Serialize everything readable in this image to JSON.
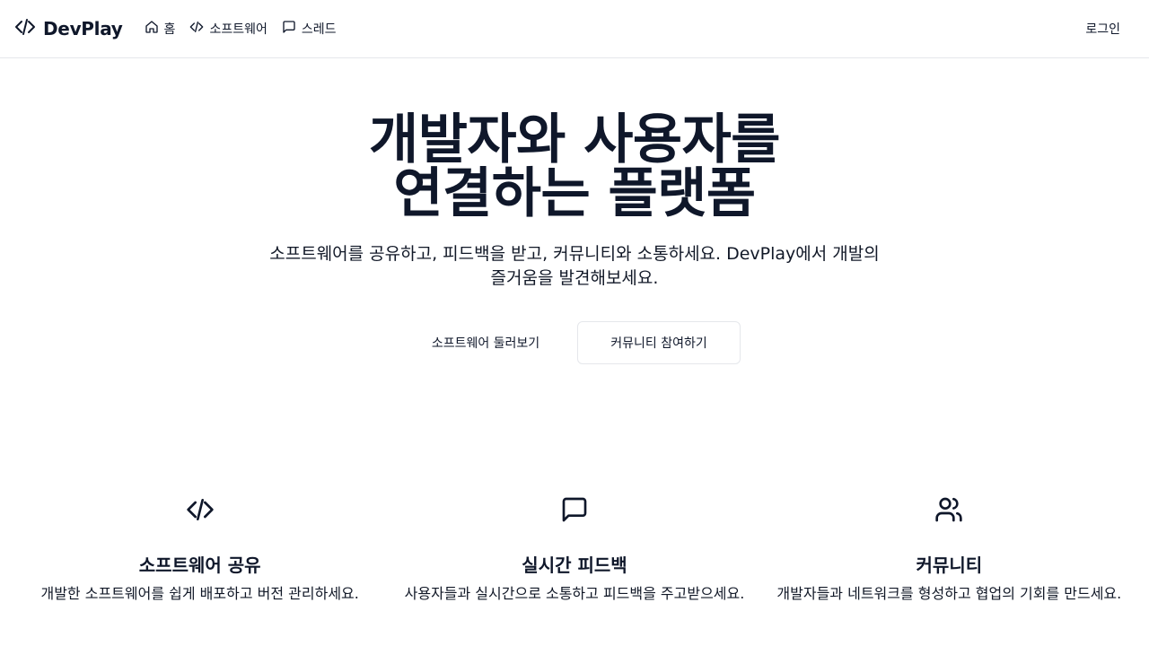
{
  "brand": {
    "name": "DevPlay",
    "icon": "code-icon"
  },
  "nav": {
    "items": [
      {
        "label": "홈",
        "icon": "home-icon"
      },
      {
        "label": "소프트웨어",
        "icon": "code-icon"
      },
      {
        "label": "스레드",
        "icon": "message-square-icon"
      }
    ],
    "login_label": "로그인"
  },
  "hero": {
    "title_line1": "개발자와 사용자를",
    "title_line2": "연결하는 플랫폼",
    "subtitle": "소프트웨어를 공유하고, 피드백을 받고, 커뮤니티와 소통하세요. DevPlay에서 개발의 즐거움을 발견해보세요.",
    "primary_button": "소프트웨어 둘러보기",
    "secondary_button": "커뮤니티 참여하기"
  },
  "features": [
    {
      "icon": "code-icon",
      "title": "소프트웨어 공유",
      "description": "개발한 소프트웨어를 쉽게 배포하고 버전 관리하세요."
    },
    {
      "icon": "message-square-icon",
      "title": "실시간 피드백",
      "description": "사용자들과 실시간으로 소통하고 피드백을 주고받으세요."
    },
    {
      "icon": "users-icon",
      "title": "커뮤니티",
      "description": "개발자들과 네트워크를 형성하고 협업의 기회를 만드세요."
    }
  ],
  "colors": {
    "text": "#0f172a",
    "border": "#e5e7eb",
    "background": "#ffffff"
  }
}
